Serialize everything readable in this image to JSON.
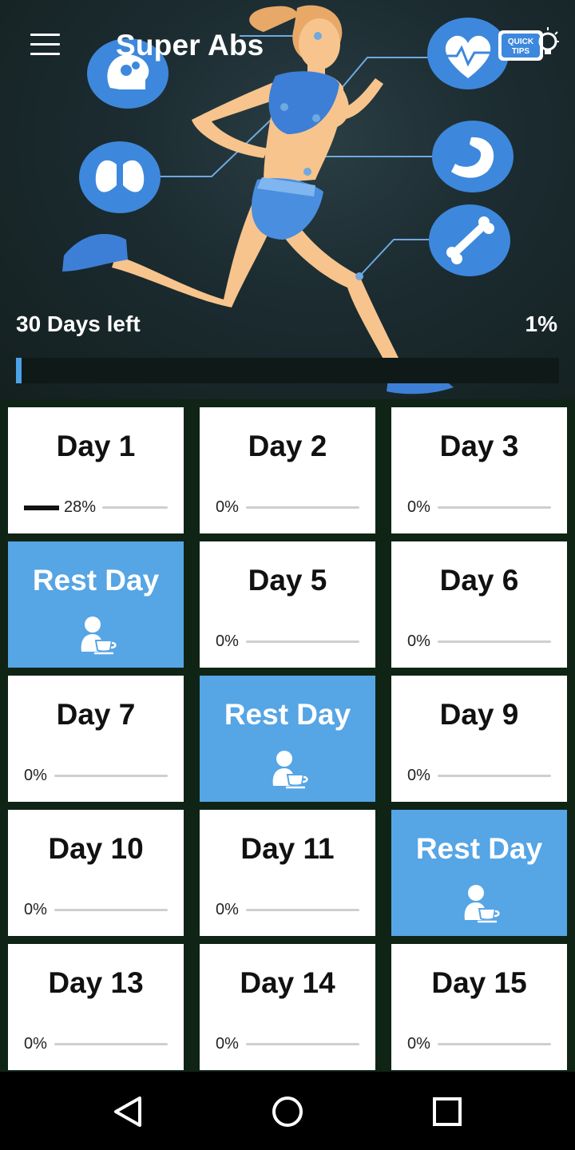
{
  "app": {
    "title": "Super Abs",
    "menu_icon": "hamburger-menu-icon",
    "tips_icon": "quick-tips-lightbulb-icon",
    "tips_text_1": "QUICK",
    "tips_text_2": "TIPS"
  },
  "progress": {
    "days_left": "30 Days left",
    "percent_label": "1%",
    "value": 0.01
  },
  "colors": {
    "accent": "#56a5e5",
    "card": "#ffffff",
    "background": "#0f2415",
    "hero": "#1b2b30"
  },
  "days": [
    {
      "label": "Day 1",
      "type": "workout",
      "pct": "28%",
      "value": 0.28
    },
    {
      "label": "Day 2",
      "type": "workout",
      "pct": "0%",
      "value": 0
    },
    {
      "label": "Day 3",
      "type": "workout",
      "pct": "0%",
      "value": 0
    },
    {
      "label": "Rest Day",
      "type": "rest",
      "icon": "rest-coffee-icon"
    },
    {
      "label": "Day 5",
      "type": "workout",
      "pct": "0%",
      "value": 0
    },
    {
      "label": "Day 6",
      "type": "workout",
      "pct": "0%",
      "value": 0
    },
    {
      "label": "Day 7",
      "type": "workout",
      "pct": "0%",
      "value": 0
    },
    {
      "label": "Rest Day",
      "type": "rest",
      "icon": "rest-coffee-icon"
    },
    {
      "label": "Day 9",
      "type": "workout",
      "pct": "0%",
      "value": 0
    },
    {
      "label": "Day 10",
      "type": "workout",
      "pct": "0%",
      "value": 0
    },
    {
      "label": "Day 11",
      "type": "workout",
      "pct": "0%",
      "value": 0
    },
    {
      "label": "Rest Day",
      "type": "rest",
      "icon": "rest-coffee-icon"
    },
    {
      "label": "Day 13",
      "type": "workout",
      "pct": "0%",
      "value": 0
    },
    {
      "label": "Day 14",
      "type": "workout",
      "pct": "0%",
      "value": 0
    },
    {
      "label": "Day 15",
      "type": "workout",
      "pct": "0%",
      "value": 0
    }
  ],
  "navbar": {
    "back_icon": "back-triangle-icon",
    "home_icon": "home-circle-icon",
    "recents_icon": "recents-square-icon"
  }
}
